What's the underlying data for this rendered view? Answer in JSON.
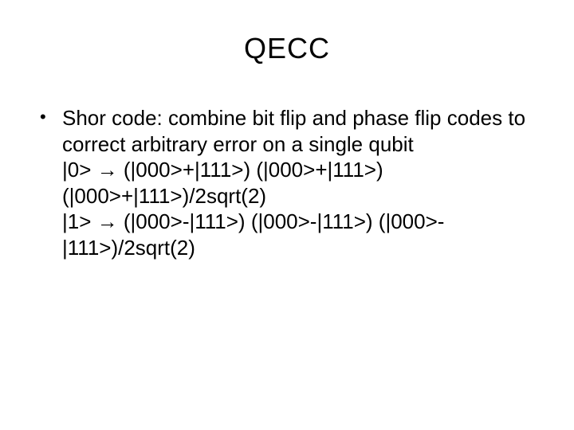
{
  "title": "QECC",
  "bullet": {
    "mark": "•",
    "text": "Shor code: combine bit flip and phase flip codes to correct arbitrary error on a single qubit"
  },
  "eq1": "|0> → (|000>+|111>) (|000>+|111>) (|000>+|111>)/2sqrt(2)",
  "eq2": "|1> → (|000>-|111>) (|000>-|111>) (|000>-|111>)/2sqrt(2)"
}
